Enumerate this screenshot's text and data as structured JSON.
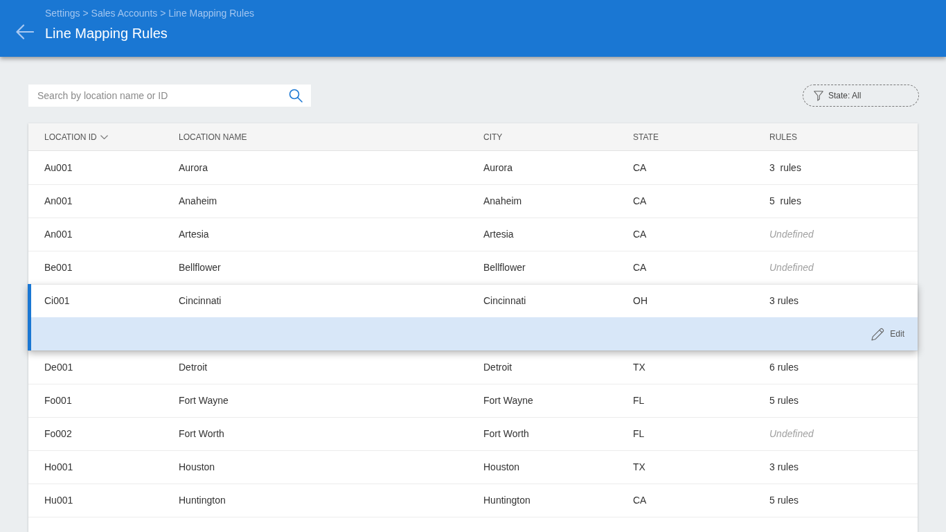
{
  "header": {
    "breadcrumb": "Settings > Sales Accounts > Line Mapping Rules",
    "title": "Line Mapping Rules"
  },
  "search": {
    "placeholder": "Search by location name or ID"
  },
  "filter": {
    "label": "State: All"
  },
  "table": {
    "columns": [
      {
        "label": "LOCATION ID",
        "sorted": true
      },
      {
        "label": "LOCATION NAME",
        "sorted": false
      },
      {
        "label": "CITY",
        "sorted": false
      },
      {
        "label": "STATE",
        "sorted": false
      },
      {
        "label": "RULES",
        "sorted": false
      }
    ],
    "rows": [
      {
        "id": "Au001",
        "name": "Aurora",
        "city": "Aurora",
        "state": "CA",
        "rules": "3  rules",
        "undefined": false,
        "selected": false
      },
      {
        "id": "An001",
        "name": "Anaheim",
        "city": "Anaheim",
        "state": "CA",
        "rules": "5  rules",
        "undefined": false,
        "selected": false
      },
      {
        "id": "An001",
        "name": "Artesia",
        "city": "Artesia",
        "state": "CA",
        "rules": "Undefined",
        "undefined": true,
        "selected": false
      },
      {
        "id": "Be001",
        "name": "Bellflower",
        "city": "Bellflower",
        "state": "CA",
        "rules": "Undefined",
        "undefined": true,
        "selected": false
      },
      {
        "id": "Ci001",
        "name": "Cincinnati",
        "city": "Cincinnati",
        "state": "OH",
        "rules": "3 rules",
        "undefined": false,
        "selected": true
      },
      {
        "id": "De001",
        "name": "Detroit",
        "city": "Detroit",
        "state": "TX",
        "rules": "6 rules",
        "undefined": false,
        "selected": false
      },
      {
        "id": "Fo001",
        "name": "Fort Wayne",
        "city": "Fort Wayne",
        "state": "FL",
        "rules": "5 rules",
        "undefined": false,
        "selected": false
      },
      {
        "id": "Fo002",
        "name": "Fort Worth",
        "city": "Fort Worth",
        "state": "FL",
        "rules": "Undefined",
        "undefined": true,
        "selected": false
      },
      {
        "id": "Ho001",
        "name": "Houston",
        "city": "Houston",
        "state": "TX",
        "rules": "3 rules",
        "undefined": false,
        "selected": false
      },
      {
        "id": "Hu001",
        "name": "Huntington",
        "city": "Huntington",
        "state": "CA",
        "rules": "5 rules",
        "undefined": false,
        "selected": false
      }
    ],
    "row_action": {
      "label": "Edit"
    }
  }
}
